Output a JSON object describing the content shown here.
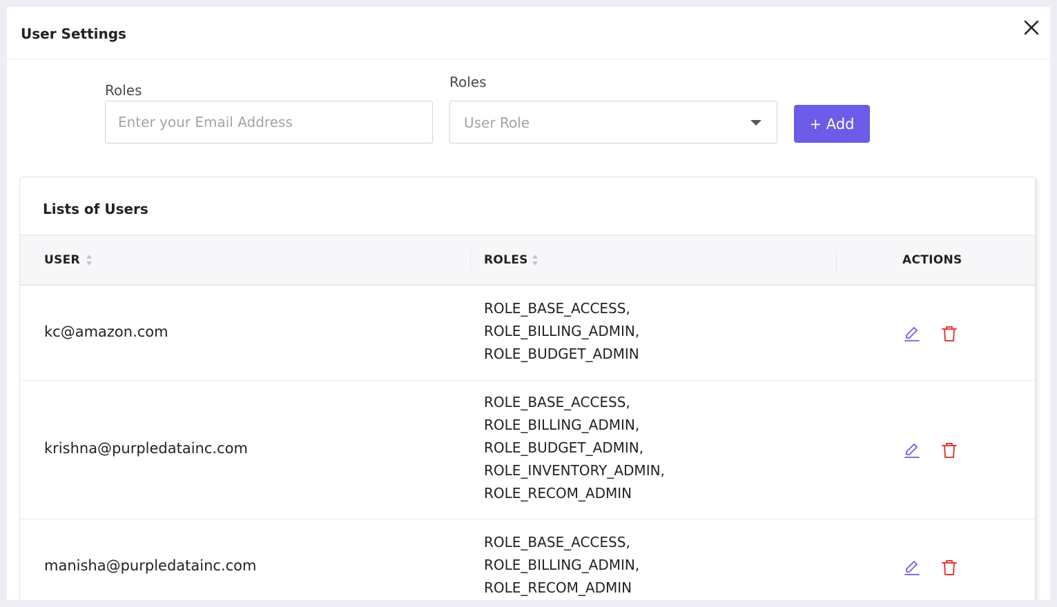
{
  "modal": {
    "title": "User Settings"
  },
  "form": {
    "email_label": "Roles",
    "email_placeholder": "Enter your Email Address",
    "role_label": "Roles",
    "role_value": "User Role",
    "add_label": "+ Add"
  },
  "users_table": {
    "title": "Lists of Users",
    "headers": {
      "user": "USER",
      "roles": "ROLES",
      "actions": "ACTIONS"
    },
    "rows": [
      {
        "user": "kc@amazon.com",
        "roles": [
          "ROLE_BASE_ACCESS,",
          "ROLE_BILLING_ADMIN,",
          "ROLE_BUDGET_ADMIN"
        ]
      },
      {
        "user": "krishna@purpledatainc.com",
        "roles": [
          "ROLE_BASE_ACCESS,",
          "ROLE_BILLING_ADMIN,",
          "ROLE_BUDGET_ADMIN,",
          "ROLE_INVENTORY_ADMIN,",
          "ROLE_RECOM_ADMIN"
        ]
      },
      {
        "user": "manisha@purpledatainc.com",
        "roles": [
          "ROLE_BASE_ACCESS,",
          "ROLE_BILLING_ADMIN,",
          "ROLE_RECOM_ADMIN"
        ]
      }
    ]
  },
  "icons": {
    "close": "close-icon",
    "sort": "sort-icon",
    "edit": "pencil-icon",
    "delete": "trash-icon",
    "dropdown": "chevron-down-icon"
  },
  "colors": {
    "accent": "#6c5ce7",
    "edit_icon": "#6c5ce7",
    "delete_icon": "#e53935"
  }
}
